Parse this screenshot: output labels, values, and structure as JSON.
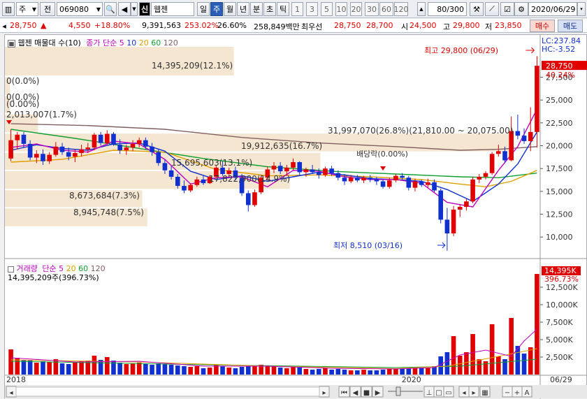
{
  "toolbar": {
    "type_label": "주",
    "prev_label": "전",
    "code": "069080",
    "name_badge": "신",
    "name": "웹젠",
    "period_tabs": [
      "일",
      "주",
      "월",
      "년",
      "분",
      "초",
      "틱"
    ],
    "active_period": "주",
    "intervals": [
      "1",
      "3",
      "5",
      "10",
      "20",
      "30",
      "60",
      "120"
    ],
    "count": "80",
    "count_total": "/300",
    "date": "2020/06/29"
  },
  "quote": {
    "price": "28,750",
    "arrow": "▲",
    "change": "4,550",
    "change_pct": "+18.80%",
    "volume": "9,391,563",
    "volume_ratio": "253.02%",
    "turnover": "26.60%",
    "amount": "258,849백만",
    "best_label": "최우선",
    "ask": "28,750",
    "bid": "28,700",
    "open_label": "시",
    "open": "24,500",
    "high_label": "고",
    "high": "29,800",
    "low_label": "저",
    "low": "23,850",
    "buy_label": "매수",
    "sell_label": "매도"
  },
  "price_panel": {
    "legend_name": "웹젠 매물대 수(10)",
    "legend_ma": "종가 단순",
    "ma_periods": [
      "5",
      "10",
      "20",
      "60",
      "120"
    ],
    "ma_colors": [
      "#c000c0",
      "#1030d0",
      "#e0a000",
      "#10a030",
      "#806060"
    ],
    "lc_label": "LC:237.84",
    "hc_label": "HC:-3.52",
    "last_price_tag": "28,750",
    "last_pct_tag": "40.24%",
    "high_note": "최고 29,800 (06/29)",
    "low_note": "최저 8,510 (03/16)",
    "dividend_note": "배당락(0.00%)",
    "y_ticks": [
      "27,500",
      "25,000",
      "22,500",
      "20,000",
      "17,500",
      "15,000",
      "12,500",
      "10,000"
    ],
    "profile_labels": [
      "14,395,209(12.1%)",
      "0(0.0%)",
      "0(0.0%)",
      "(0.00%)",
      "2,013,007(1.7%)",
      "31,997,070(26.8%)(21,810.00 ~ 20,075.00)",
      "19,912,635(16.7%)",
      "15,695,603(13.1%)",
      "17,822,900(14.9%)",
      "8,673,684(7.3%)",
      "8,945,748(7.5%)"
    ]
  },
  "volume_panel": {
    "legend_name": "거래량",
    "legend_ma": "단순",
    "ma_periods": [
      "5",
      "20",
      "60",
      "120"
    ],
    "sub_label": "14,395,209주(396.73%)",
    "last_tag": "14,395K",
    "last_pct_tag": "396.73%",
    "y_ticks": [
      "12,500K",
      "10,000K",
      "7,500K",
      "5,000K",
      "2,500K"
    ]
  },
  "x_axis": {
    "labels": [
      "2018",
      "2020"
    ],
    "last_date": "06/29"
  },
  "colors": {
    "up": "#e00000",
    "down": "#1030d0",
    "profile": "#f5e6d2",
    "accent": "#2b5fb5"
  },
  "chart_data": {
    "type": "candlestick",
    "y_range": [
      7800,
      30900
    ],
    "volume_range_k": [
      0,
      14800
    ],
    "candles": [
      {
        "o": 18600,
        "h": 21800,
        "l": 18300,
        "c": 20600,
        "v": 3600
      },
      {
        "o": 20600,
        "h": 21500,
        "l": 19600,
        "c": 21200,
        "v": 2400
      },
      {
        "o": 21200,
        "h": 21500,
        "l": 19800,
        "c": 20200,
        "v": 2100
      },
      {
        "o": 20200,
        "h": 20600,
        "l": 18400,
        "c": 18700,
        "v": 2000
      },
      {
        "o": 18700,
        "h": 19500,
        "l": 18100,
        "c": 19100,
        "v": 1700
      },
      {
        "o": 19100,
        "h": 19600,
        "l": 17900,
        "c": 18300,
        "v": 1900
      },
      {
        "o": 18300,
        "h": 19300,
        "l": 18000,
        "c": 19000,
        "v": 1800
      },
      {
        "o": 19000,
        "h": 20400,
        "l": 18800,
        "c": 19900,
        "v": 2200
      },
      {
        "o": 19900,
        "h": 20300,
        "l": 19000,
        "c": 19300,
        "v": 1600
      },
      {
        "o": 19300,
        "h": 19800,
        "l": 18400,
        "c": 18800,
        "v": 1500
      },
      {
        "o": 18800,
        "h": 19600,
        "l": 18200,
        "c": 19200,
        "v": 1700
      },
      {
        "o": 19200,
        "h": 20100,
        "l": 18800,
        "c": 19600,
        "v": 1900
      },
      {
        "o": 19600,
        "h": 20300,
        "l": 19200,
        "c": 19800,
        "v": 2000
      },
      {
        "o": 19800,
        "h": 21400,
        "l": 19500,
        "c": 21200,
        "v": 2700
      },
      {
        "o": 21200,
        "h": 21500,
        "l": 20000,
        "c": 20300,
        "v": 2100
      },
      {
        "o": 20300,
        "h": 21700,
        "l": 20100,
        "c": 21300,
        "v": 2500
      },
      {
        "o": 21300,
        "h": 21500,
        "l": 20000,
        "c": 20100,
        "v": 2000
      },
      {
        "o": 20100,
        "h": 20700,
        "l": 19100,
        "c": 19500,
        "v": 1700
      },
      {
        "o": 19500,
        "h": 20100,
        "l": 19000,
        "c": 19800,
        "v": 1500
      },
      {
        "o": 19800,
        "h": 20600,
        "l": 19400,
        "c": 20200,
        "v": 1600
      },
      {
        "o": 20200,
        "h": 20900,
        "l": 19800,
        "c": 20600,
        "v": 1700
      },
      {
        "o": 20600,
        "h": 20900,
        "l": 19600,
        "c": 19900,
        "v": 1500
      },
      {
        "o": 19900,
        "h": 20300,
        "l": 18900,
        "c": 19300,
        "v": 1400
      },
      {
        "o": 19300,
        "h": 19600,
        "l": 17800,
        "c": 18100,
        "v": 1600
      },
      {
        "o": 18100,
        "h": 18500,
        "l": 16900,
        "c": 17300,
        "v": 1500
      },
      {
        "o": 17300,
        "h": 17800,
        "l": 16300,
        "c": 16600,
        "v": 1400
      },
      {
        "o": 16600,
        "h": 16900,
        "l": 15300,
        "c": 15600,
        "v": 1300
      },
      {
        "o": 15600,
        "h": 16200,
        "l": 14800,
        "c": 15100,
        "v": 1200
      },
      {
        "o": 15100,
        "h": 15900,
        "l": 14900,
        "c": 15700,
        "v": 1100
      },
      {
        "o": 15700,
        "h": 16600,
        "l": 15500,
        "c": 16300,
        "v": 1200
      },
      {
        "o": 16300,
        "h": 16700,
        "l": 15700,
        "c": 15900,
        "v": 900
      },
      {
        "o": 15900,
        "h": 16800,
        "l": 15800,
        "c": 16600,
        "v": 1000
      },
      {
        "o": 16600,
        "h": 17900,
        "l": 16400,
        "c": 17600,
        "v": 1400
      },
      {
        "o": 17600,
        "h": 18300,
        "l": 16700,
        "c": 16900,
        "v": 1200
      },
      {
        "o": 16900,
        "h": 17600,
        "l": 16600,
        "c": 17300,
        "v": 1000
      },
      {
        "o": 17300,
        "h": 17700,
        "l": 16200,
        "c": 16500,
        "v": 900
      },
      {
        "o": 16500,
        "h": 16900,
        "l": 14500,
        "c": 14800,
        "v": 1100
      },
      {
        "o": 14800,
        "h": 15100,
        "l": 12800,
        "c": 13500,
        "v": 1300
      },
      {
        "o": 13500,
        "h": 15200,
        "l": 13300,
        "c": 14900,
        "v": 1200
      },
      {
        "o": 14900,
        "h": 16800,
        "l": 14700,
        "c": 16500,
        "v": 1400
      },
      {
        "o": 16500,
        "h": 17700,
        "l": 16200,
        "c": 17400,
        "v": 1300
      },
      {
        "o": 17400,
        "h": 18200,
        "l": 17000,
        "c": 17800,
        "v": 1200
      },
      {
        "o": 17800,
        "h": 18200,
        "l": 16900,
        "c": 17200,
        "v": 1000
      },
      {
        "o": 17200,
        "h": 17900,
        "l": 16700,
        "c": 17600,
        "v": 900
      },
      {
        "o": 17600,
        "h": 18600,
        "l": 17300,
        "c": 18200,
        "v": 1100
      },
      {
        "o": 18200,
        "h": 18300,
        "l": 16800,
        "c": 17100,
        "v": 1000
      },
      {
        "o": 17100,
        "h": 17600,
        "l": 16600,
        "c": 17400,
        "v": 800
      },
      {
        "o": 17400,
        "h": 17900,
        "l": 16900,
        "c": 17100,
        "v": 700
      },
      {
        "o": 17100,
        "h": 17500,
        "l": 16400,
        "c": 16800,
        "v": 800
      },
      {
        "o": 16800,
        "h": 17700,
        "l": 16600,
        "c": 17500,
        "v": 900
      },
      {
        "o": 17500,
        "h": 17800,
        "l": 16700,
        "c": 17000,
        "v": 700
      },
      {
        "o": 17000,
        "h": 17300,
        "l": 16200,
        "c": 16500,
        "v": 800
      },
      {
        "o": 16500,
        "h": 16900,
        "l": 15700,
        "c": 16100,
        "v": 700
      },
      {
        "o": 16100,
        "h": 16800,
        "l": 15900,
        "c": 16500,
        "v": 600
      },
      {
        "o": 16500,
        "h": 16800,
        "l": 16000,
        "c": 16200,
        "v": 600
      },
      {
        "o": 16200,
        "h": 16700,
        "l": 15900,
        "c": 16500,
        "v": 700
      },
      {
        "o": 16500,
        "h": 16800,
        "l": 16000,
        "c": 16300,
        "v": 600
      },
      {
        "o": 16300,
        "h": 16600,
        "l": 15700,
        "c": 16100,
        "v": 600
      },
      {
        "o": 16100,
        "h": 16300,
        "l": 15300,
        "c": 15500,
        "v": 700
      },
      {
        "o": 15500,
        "h": 16500,
        "l": 15300,
        "c": 16200,
        "v": 800
      },
      {
        "o": 16200,
        "h": 16900,
        "l": 16000,
        "c": 16700,
        "v": 900
      },
      {
        "o": 16700,
        "h": 17000,
        "l": 16300,
        "c": 16500,
        "v": 800
      },
      {
        "o": 16500,
        "h": 16700,
        "l": 15100,
        "c": 15400,
        "v": 900
      },
      {
        "o": 15400,
        "h": 16400,
        "l": 15000,
        "c": 16100,
        "v": 1000
      },
      {
        "o": 16100,
        "h": 16300,
        "l": 15500,
        "c": 15700,
        "v": 900
      },
      {
        "o": 15700,
        "h": 16400,
        "l": 15400,
        "c": 16000,
        "v": 1000
      },
      {
        "o": 16000,
        "h": 16300,
        "l": 14900,
        "c": 15100,
        "v": 1200
      },
      {
        "o": 15100,
        "h": 15300,
        "l": 11500,
        "c": 11900,
        "v": 2600
      },
      {
        "o": 11900,
        "h": 13200,
        "l": 8510,
        "c": 10400,
        "v": 3200
      },
      {
        "o": 10400,
        "h": 13400,
        "l": 10100,
        "c": 13000,
        "v": 5500
      },
      {
        "o": 13000,
        "h": 13600,
        "l": 12200,
        "c": 13300,
        "v": 2700
      },
      {
        "o": 13300,
        "h": 14200,
        "l": 12900,
        "c": 13900,
        "v": 3200
      },
      {
        "o": 13900,
        "h": 16600,
        "l": 13700,
        "c": 16300,
        "v": 5800
      },
      {
        "o": 16300,
        "h": 16900,
        "l": 15900,
        "c": 16600,
        "v": 2200
      },
      {
        "o": 16600,
        "h": 17200,
        "l": 16300,
        "c": 17000,
        "v": 1900
      },
      {
        "o": 17000,
        "h": 19300,
        "l": 16800,
        "c": 19100,
        "v": 7200
      },
      {
        "o": 19100,
        "h": 20100,
        "l": 18800,
        "c": 19400,
        "v": 2600
      },
      {
        "o": 19400,
        "h": 19900,
        "l": 18100,
        "c": 18400,
        "v": 2200
      },
      {
        "o": 18400,
        "h": 23200,
        "l": 18300,
        "c": 21600,
        "v": 8100
      },
      {
        "o": 21600,
        "h": 23400,
        "l": 20700,
        "c": 21100,
        "v": 4100
      },
      {
        "o": 21100,
        "h": 21900,
        "l": 20200,
        "c": 20500,
        "v": 3000
      },
      {
        "o": 20500,
        "h": 24200,
        "l": 19400,
        "c": 21500,
        "v": 3900
      },
      {
        "o": 21500,
        "h": 29800,
        "l": 19800,
        "c": 28750,
        "v": 14395
      }
    ],
    "ma_lines": [
      {
        "name": "5",
        "color": "#c000c0",
        "points": [
          [
            0,
            19800
          ],
          [
            4,
            20200
          ],
          [
            8,
            19500
          ],
          [
            12,
            19300
          ],
          [
            16,
            20500
          ],
          [
            20,
            20200
          ],
          [
            24,
            18500
          ],
          [
            28,
            15800
          ],
          [
            32,
            16500
          ],
          [
            36,
            16600
          ],
          [
            40,
            15500
          ],
          [
            44,
            17300
          ],
          [
            48,
            17200
          ],
          [
            52,
            16600
          ],
          [
            56,
            16300
          ],
          [
            60,
            16300
          ],
          [
            64,
            15900
          ],
          [
            68,
            13800
          ],
          [
            72,
            13300
          ],
          [
            76,
            17300
          ],
          [
            79,
            19900
          ],
          [
            82,
            24000
          ]
        ]
      },
      {
        "name": "10",
        "color": "#1030d0",
        "points": [
          [
            0,
            19500
          ],
          [
            4,
            20100
          ],
          [
            8,
            19700
          ],
          [
            12,
            19500
          ],
          [
            16,
            20200
          ],
          [
            20,
            20300
          ],
          [
            24,
            19400
          ],
          [
            28,
            17200
          ],
          [
            32,
            16300
          ],
          [
            36,
            16700
          ],
          [
            40,
            16100
          ],
          [
            44,
            16600
          ],
          [
            48,
            17100
          ],
          [
            52,
            16800
          ],
          [
            56,
            16400
          ],
          [
            60,
            16300
          ],
          [
            64,
            16100
          ],
          [
            68,
            15200
          ],
          [
            72,
            13900
          ],
          [
            76,
            15800
          ],
          [
            79,
            18000
          ],
          [
            82,
            21500
          ]
        ]
      },
      {
        "name": "20",
        "color": "#e0a000",
        "points": [
          [
            0,
            18200
          ],
          [
            8,
            18500
          ],
          [
            16,
            19500
          ],
          [
            24,
            19300
          ],
          [
            32,
            17400
          ],
          [
            40,
            16700
          ],
          [
            48,
            16800
          ],
          [
            56,
            16600
          ],
          [
            64,
            16300
          ],
          [
            70,
            15800
          ],
          [
            74,
            15500
          ],
          [
            78,
            16100
          ],
          [
            82,
            17300
          ]
        ]
      },
      {
        "name": "60",
        "color": "#10a030",
        "points": [
          [
            0,
            21800
          ],
          [
            10,
            20800
          ],
          [
            20,
            19700
          ],
          [
            30,
            18600
          ],
          [
            40,
            17700
          ],
          [
            50,
            17200
          ],
          [
            60,
            16900
          ],
          [
            70,
            16600
          ],
          [
            76,
            16500
          ],
          [
            82,
            17000
          ]
        ]
      },
      {
        "name": "120",
        "color": "#806060",
        "points": [
          [
            0,
            22400
          ],
          [
            12,
            22200
          ],
          [
            24,
            21800
          ],
          [
            36,
            20900
          ],
          [
            48,
            20300
          ],
          [
            60,
            19900
          ],
          [
            70,
            19500
          ],
          [
            76,
            19600
          ],
          [
            82,
            19900
          ]
        ]
      }
    ],
    "volume_ma": [
      {
        "name": "5",
        "color": "#c000c0",
        "points": [
          [
            0,
            2400
          ],
          [
            10,
            1800
          ],
          [
            20,
            1900
          ],
          [
            30,
            1200
          ],
          [
            40,
            1200
          ],
          [
            50,
            900
          ],
          [
            60,
            800
          ],
          [
            66,
            1000
          ],
          [
            70,
            2800
          ],
          [
            74,
            3500
          ],
          [
            78,
            2600
          ],
          [
            80,
            4800
          ],
          [
            82,
            6500
          ]
        ]
      },
      {
        "name": "20",
        "color": "#e0a000",
        "points": [
          [
            0,
            2100
          ],
          [
            20,
            1800
          ],
          [
            40,
            1200
          ],
          [
            60,
            850
          ],
          [
            68,
            1200
          ],
          [
            76,
            2600
          ],
          [
            82,
            3700
          ]
        ]
      },
      {
        "name": "60",
        "color": "#10a030",
        "points": [
          [
            0,
            1900
          ],
          [
            30,
            1400
          ],
          [
            60,
            1000
          ],
          [
            70,
            1200
          ],
          [
            82,
            2200
          ]
        ]
      }
    ],
    "profile_rows": [
      {
        "lo": 27600,
        "hi": 30900,
        "w": 0.45
      },
      {
        "lo": 25500,
        "hi": 27600,
        "w": 0.01
      },
      {
        "lo": 23500,
        "hi": 25500,
        "w": 0.01
      },
      {
        "lo": 21400,
        "hi": 23500,
        "w": 0.065
      },
      {
        "lo": 19300,
        "hi": 21400,
        "w": 1.0
      },
      {
        "lo": 17300,
        "hi": 19300,
        "w": 0.62
      },
      {
        "lo": 15200,
        "hi": 17300,
        "w": 0.56
      },
      {
        "lo": 13200,
        "hi": 15200,
        "w": 0.27
      },
      {
        "lo": 11100,
        "hi": 13200,
        "w": 0.28
      }
    ]
  }
}
